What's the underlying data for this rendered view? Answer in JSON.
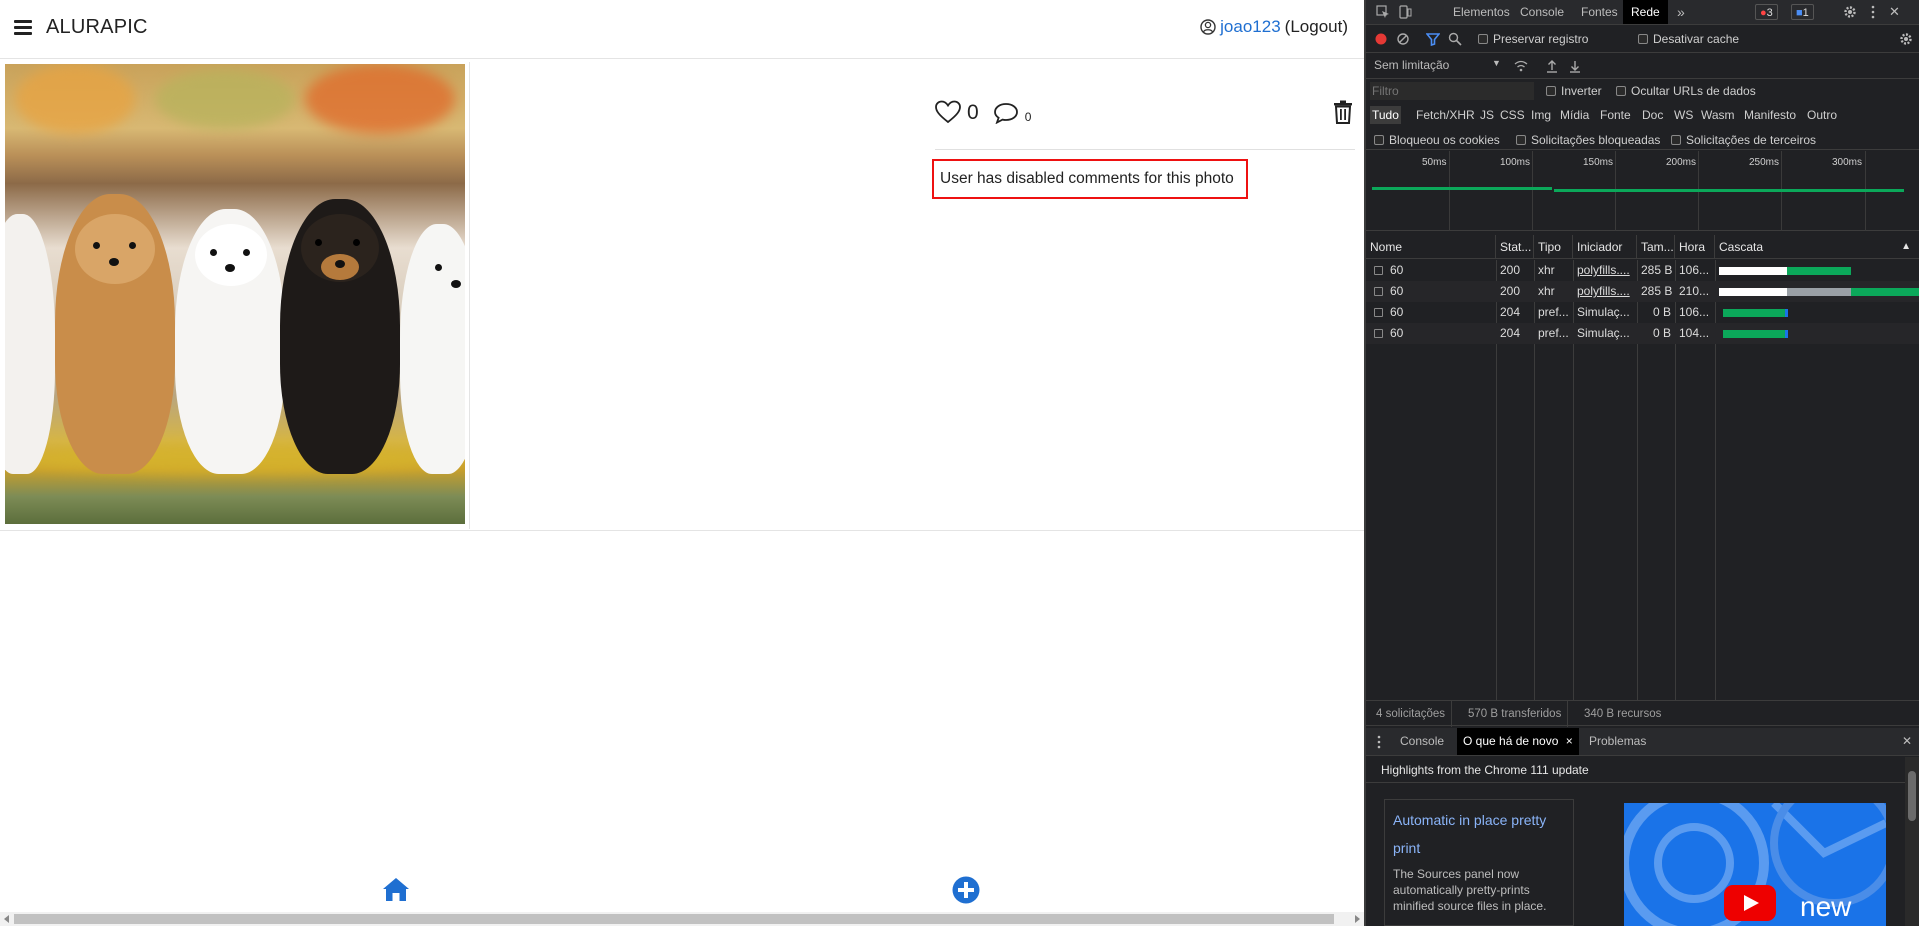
{
  "app": {
    "brand": "ALURAPIC",
    "username": "joao123",
    "logout_label": "(Logout)",
    "photo": {
      "likes": "0",
      "comments": "0",
      "comments_disabled_message": "User has disabled comments for this photo"
    }
  },
  "devtools": {
    "tabs": [
      "Elementos",
      "Console",
      "Fontes",
      "Rede"
    ],
    "active_tab": "Rede",
    "more_tabs": "»",
    "error_count": "3",
    "message_count": "1",
    "toolbar": {
      "preserve_log": "Preservar registro",
      "disable_cache": "Desativar cache",
      "throttling": "Sem limitação"
    },
    "filter": {
      "placeholder": "Filtro",
      "invert": "Inverter",
      "hide_data_urls": "Ocultar URLs de dados"
    },
    "type_filters": [
      "Tudo",
      "Fetch/XHR",
      "JS",
      "CSS",
      "Img",
      "Mídia",
      "Fonte",
      "Doc",
      "WS",
      "Wasm",
      "Manifesto",
      "Outro"
    ],
    "active_type": "Tudo",
    "blocked_filters": [
      "Bloqueou os cookies",
      "Solicitações bloqueadas",
      "Solicitações de terceiros"
    ],
    "timeline_ticks": [
      "50ms",
      "100ms",
      "150ms",
      "200ms",
      "250ms",
      "300ms"
    ],
    "columns": [
      "Nome",
      "Stat...",
      "Tipo",
      "Iniciador",
      "Tam...",
      "Hora",
      "Cascata"
    ],
    "sort_indicator": "▲",
    "requests": [
      {
        "name": "60",
        "status": "200",
        "type": "xhr",
        "initiator": "polyfills....",
        "size": "285 B",
        "time": "106..."
      },
      {
        "name": "60",
        "status": "200",
        "type": "xhr",
        "initiator": "polyfills....",
        "size": "285 B",
        "time": "210..."
      },
      {
        "name": "60",
        "status": "204",
        "type": "pref...",
        "initiator": "Simulaç...",
        "size": "0 B",
        "time": "106..."
      },
      {
        "name": "60",
        "status": "204",
        "type": "pref...",
        "initiator": "Simulaç...",
        "size": "0 B",
        "time": "104..."
      }
    ],
    "status_bar": {
      "requests": "4 solicitações",
      "transferred": "570 B transferidos",
      "resources": "340 B recursos"
    },
    "drawer": {
      "tabs": [
        "Console",
        "O que há de novo",
        "Problemas"
      ],
      "active_tab": "O que há de novo",
      "close_tab_glyph": "×",
      "close_drawer_glyph": "✕",
      "highlights_title": "Highlights from the Chrome 111 update",
      "news_title": "Automatic in place pretty print",
      "news_text": "The Sources panel now automatically pretty-prints minified source files in place.",
      "video_label": "new"
    },
    "close_glyph": "✕",
    "colors": {
      "record_red": "#e53935",
      "waterfall_green": "#0ba85a",
      "link_blue": "#8ab4f8"
    }
  },
  "colors": {
    "accent_blue": "#1f6fd1",
    "highlight_red": "#ee1111"
  }
}
